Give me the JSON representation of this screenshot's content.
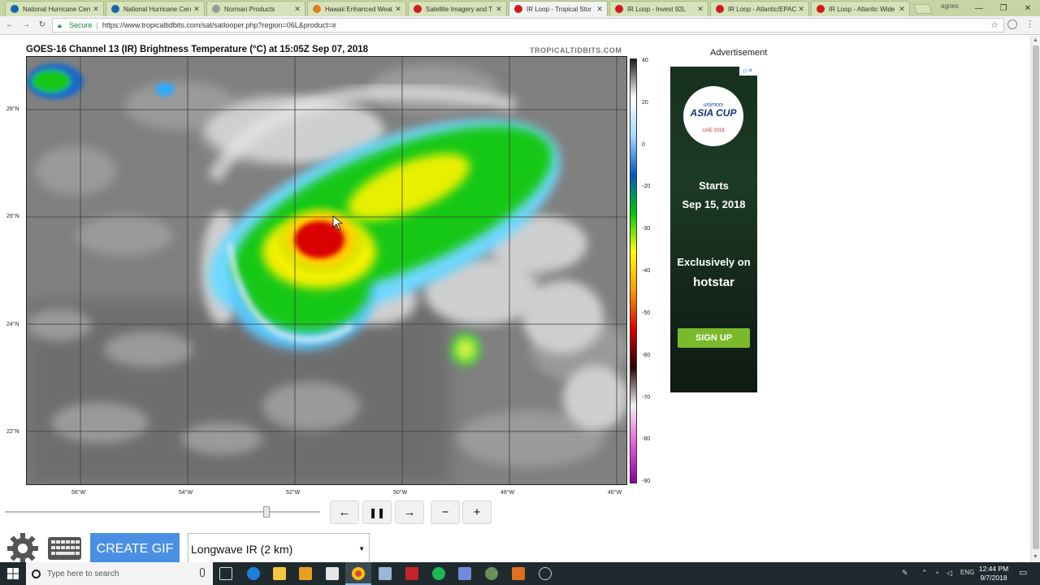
{
  "browser": {
    "tabs": [
      {
        "label": "National Hurricane Cen",
        "favicon_color": "#1a63b0",
        "active": false
      },
      {
        "label": "National Hurricane Cen",
        "favicon_color": "#1a63b0",
        "active": false
      },
      {
        "label": "Norman Products",
        "favicon_color": "#9a9a9a",
        "active": false
      },
      {
        "label": "Hawaii Enhanced Weat",
        "favicon_color": "#e07a1f",
        "active": false
      },
      {
        "label": "Satellite Imagery and T",
        "favicon_color": "#d11a1a",
        "active": false
      },
      {
        "label": "IR Loop - Tropical Stor",
        "favicon_color": "#d11a1a",
        "active": true
      },
      {
        "label": "IR Loop - Invest 92L",
        "favicon_color": "#d11a1a",
        "active": false
      },
      {
        "label": "IR Loop - Atlantic/EPAC",
        "favicon_color": "#d11a1a",
        "active": false
      },
      {
        "label": "IR Loop - Atlantic Wide",
        "favicon_color": "#d11a1a",
        "active": false
      }
    ],
    "secure_label": "Secure",
    "url": "https://www.tropicaltidbits.com/sat/satlooper.php?region=06L&product=ir",
    "user_badge": "agnes"
  },
  "map": {
    "title": "GOES-16 Channel 13 (IR) Brightness Temperature (°C) at 15:05Z Sep 07, 2018",
    "brand": "TROPICALTIDBITS.COM",
    "lat_labels": [
      "28°N",
      "26°N",
      "24°N",
      "22°N"
    ],
    "lon_labels": [
      "56°W",
      "54°W",
      "52°W",
      "50°W",
      "48°W",
      "46°W"
    ],
    "colorbar_ticks": [
      "40",
      "20",
      "0",
      "-20",
      "-30",
      "-40",
      "-50",
      "-60",
      "-70",
      "-80",
      "-90"
    ],
    "colorbar_colors": [
      "#1a1a1a",
      "#ffffff",
      "#9fd8ff",
      "#0057c8",
      "#00c800",
      "#ffff00",
      "#ff9c00",
      "#e00000",
      "#2a0000",
      "#f0f0f0",
      "#e85ad8",
      "#8a00a0"
    ]
  },
  "ad": {
    "label": "Advertisement",
    "logo_sponsor": "unimoni",
    "logo_title": "ASIA CUP",
    "logo_year": "UAE 2018",
    "line1": "Starts",
    "line2": "Sep 15, 2018",
    "line3": "Exclusively on",
    "line4": "hotstar",
    "cta": "SIGN UP",
    "choice": "▷✕"
  },
  "controls": {
    "slider_fraction": 0.83,
    "prev": "←",
    "pause": "❚❚",
    "next": "→",
    "minus": "−",
    "plus": "+",
    "create_gif": "CREATE GIF",
    "product": "Longwave IR (2 km)"
  },
  "taskbar": {
    "search_placeholder": "Type here to search",
    "lang": "ENG",
    "time": "12:44 PM",
    "date": "9/7/2018"
  }
}
